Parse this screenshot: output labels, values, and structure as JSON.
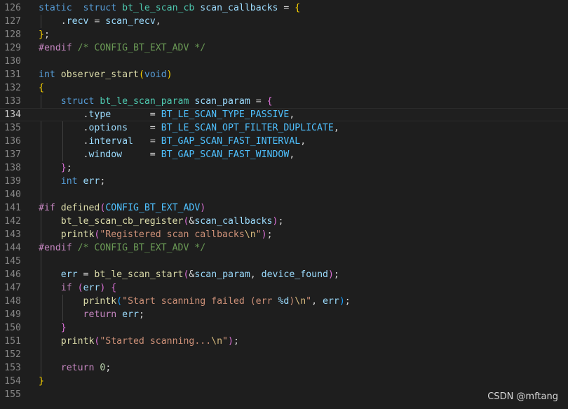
{
  "editor": {
    "language": "c",
    "current_line": "134",
    "lines": [
      {
        "n": "126",
        "tokens": [
          [
            "kw",
            "static"
          ],
          [
            "",
            "  "
          ],
          [
            "kw",
            "struct"
          ],
          [
            "",
            " "
          ],
          [
            "ty",
            "bt_le_scan_cb"
          ],
          [
            "",
            " "
          ],
          [
            "var",
            "scan_callbacks"
          ],
          [
            "",
            " = "
          ],
          [
            "br1",
            "{"
          ]
        ]
      },
      {
        "n": "127",
        "tokens": [
          [
            "",
            "    ."
          ],
          [
            "var",
            "recv"
          ],
          [
            "",
            " = "
          ],
          [
            "var",
            "scan_recv"
          ],
          [
            "",
            ","
          ]
        ]
      },
      {
        "n": "128",
        "tokens": [
          [
            "br1",
            "}"
          ],
          [
            "",
            ";"
          ]
        ]
      },
      {
        "n": "129",
        "tokens": [
          [
            "pp",
            "#endif"
          ],
          [
            "",
            " "
          ],
          [
            "cm",
            "/* CONFIG_BT_EXT_ADV */"
          ]
        ]
      },
      {
        "n": "130",
        "tokens": []
      },
      {
        "n": "131",
        "tokens": [
          [
            "kw",
            "int"
          ],
          [
            "",
            " "
          ],
          [
            "fn",
            "observer_start"
          ],
          [
            "br1",
            "("
          ],
          [
            "kw",
            "void"
          ],
          [
            "br1",
            ")"
          ]
        ]
      },
      {
        "n": "132",
        "tokens": [
          [
            "br1",
            "{"
          ]
        ]
      },
      {
        "n": "133",
        "tokens": [
          [
            "",
            "    "
          ],
          [
            "kw",
            "struct"
          ],
          [
            "",
            " "
          ],
          [
            "ty",
            "bt_le_scan_param"
          ],
          [
            "",
            " "
          ],
          [
            "var",
            "scan_param"
          ],
          [
            "",
            " = "
          ],
          [
            "br2",
            "{"
          ]
        ]
      },
      {
        "n": "134",
        "tokens": [
          [
            "",
            "        ."
          ],
          [
            "var",
            "type"
          ],
          [
            "",
            "       = "
          ],
          [
            "mac",
            "BT_LE_SCAN_TYPE_PASSIVE"
          ],
          [
            "",
            ","
          ]
        ]
      },
      {
        "n": "135",
        "tokens": [
          [
            "",
            "        ."
          ],
          [
            "var",
            "options"
          ],
          [
            "",
            "    = "
          ],
          [
            "mac",
            "BT_LE_SCAN_OPT_FILTER_DUPLICATE"
          ],
          [
            "",
            ","
          ]
        ]
      },
      {
        "n": "136",
        "tokens": [
          [
            "",
            "        ."
          ],
          [
            "var",
            "interval"
          ],
          [
            "",
            "   = "
          ],
          [
            "mac",
            "BT_GAP_SCAN_FAST_INTERVAL"
          ],
          [
            "",
            ","
          ]
        ]
      },
      {
        "n": "137",
        "tokens": [
          [
            "",
            "        ."
          ],
          [
            "var",
            "window"
          ],
          [
            "",
            "     = "
          ],
          [
            "mac",
            "BT_GAP_SCAN_FAST_WINDOW"
          ],
          [
            "",
            ","
          ]
        ]
      },
      {
        "n": "138",
        "tokens": [
          [
            "",
            "    "
          ],
          [
            "br2",
            "}"
          ],
          [
            "",
            ";"
          ]
        ]
      },
      {
        "n": "139",
        "tokens": [
          [
            "",
            "    "
          ],
          [
            "kw",
            "int"
          ],
          [
            "",
            " "
          ],
          [
            "var",
            "err"
          ],
          [
            "",
            ";"
          ]
        ]
      },
      {
        "n": "140",
        "tokens": []
      },
      {
        "n": "141",
        "tokens": [
          [
            "pp",
            "#if"
          ],
          [
            "",
            " "
          ],
          [
            "fn",
            "defined"
          ],
          [
            "br2",
            "("
          ],
          [
            "mac",
            "CONFIG_BT_EXT_ADV"
          ],
          [
            "br2",
            ")"
          ]
        ]
      },
      {
        "n": "142",
        "tokens": [
          [
            "",
            "    "
          ],
          [
            "fn",
            "bt_le_scan_cb_register"
          ],
          [
            "br2",
            "("
          ],
          [
            "",
            "&"
          ],
          [
            "var",
            "scan_callbacks"
          ],
          [
            "br2",
            ")"
          ],
          [
            "",
            ";"
          ]
        ]
      },
      {
        "n": "143",
        "tokens": [
          [
            "",
            "    "
          ],
          [
            "fn",
            "printk"
          ],
          [
            "br2",
            "("
          ],
          [
            "str",
            "\"Registered scan callbacks"
          ],
          [
            "esc",
            "\\n"
          ],
          [
            "str",
            "\""
          ],
          [
            "br2",
            ")"
          ],
          [
            "",
            ";"
          ]
        ]
      },
      {
        "n": "144",
        "tokens": [
          [
            "pp",
            "#endif"
          ],
          [
            "",
            " "
          ],
          [
            "cm",
            "/* CONFIG_BT_EXT_ADV */"
          ]
        ]
      },
      {
        "n": "145",
        "tokens": []
      },
      {
        "n": "146",
        "tokens": [
          [
            "",
            "    "
          ],
          [
            "var",
            "err"
          ],
          [
            "",
            " = "
          ],
          [
            "fn",
            "bt_le_scan_start"
          ],
          [
            "br2",
            "("
          ],
          [
            "",
            "&"
          ],
          [
            "var",
            "scan_param"
          ],
          [
            "",
            ", "
          ],
          [
            "var",
            "device_found"
          ],
          [
            "br2",
            ")"
          ],
          [
            "",
            ";"
          ]
        ]
      },
      {
        "n": "147",
        "tokens": [
          [
            "",
            "    "
          ],
          [
            "ctl",
            "if"
          ],
          [
            "",
            " "
          ],
          [
            "br2",
            "("
          ],
          [
            "var",
            "err"
          ],
          [
            "br2",
            ")"
          ],
          [
            "",
            " "
          ],
          [
            "br2",
            "{"
          ]
        ]
      },
      {
        "n": "148",
        "tokens": [
          [
            "",
            "        "
          ],
          [
            "fn",
            "printk"
          ],
          [
            "br3",
            "("
          ],
          [
            "str",
            "\"Start scanning failed (err "
          ],
          [
            "var",
            "%d"
          ],
          [
            "str",
            ")"
          ],
          [
            "esc",
            "\\n"
          ],
          [
            "str",
            "\""
          ],
          [
            "",
            ", "
          ],
          [
            "var",
            "err"
          ],
          [
            "br3",
            ")"
          ],
          [
            "",
            ";"
          ]
        ]
      },
      {
        "n": "149",
        "tokens": [
          [
            "",
            "        "
          ],
          [
            "ctl",
            "return"
          ],
          [
            "",
            " "
          ],
          [
            "var",
            "err"
          ],
          [
            "",
            ";"
          ]
        ]
      },
      {
        "n": "150",
        "tokens": [
          [
            "",
            "    "
          ],
          [
            "br2",
            "}"
          ]
        ]
      },
      {
        "n": "151",
        "tokens": [
          [
            "",
            "    "
          ],
          [
            "fn",
            "printk"
          ],
          [
            "br2",
            "("
          ],
          [
            "str",
            "\"Started scanning..."
          ],
          [
            "esc",
            "\\n"
          ],
          [
            "str",
            "\""
          ],
          [
            "br2",
            ")"
          ],
          [
            "",
            ";"
          ]
        ]
      },
      {
        "n": "152",
        "tokens": []
      },
      {
        "n": "153",
        "tokens": [
          [
            "",
            "    "
          ],
          [
            "ctl",
            "return"
          ],
          [
            "",
            " "
          ],
          [
            "num",
            "0"
          ],
          [
            "",
            ";"
          ]
        ]
      },
      {
        "n": "154",
        "tokens": [
          [
            "br1",
            "}"
          ]
        ]
      },
      {
        "n": "155",
        "tokens": []
      }
    ]
  },
  "watermark": "CSDN @mftang"
}
